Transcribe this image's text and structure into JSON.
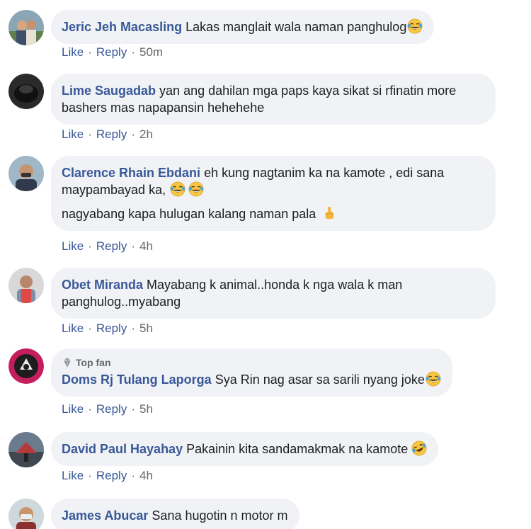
{
  "comments": [
    {
      "author": "Jeric Jeh Macasling",
      "text": "Lakas manglait wala naman panghulog",
      "emoji": "joy-emoji",
      "like": "Like",
      "reply": "Reply",
      "time": "50m"
    },
    {
      "author": "Lime Saugadab",
      "text": "yan ang dahilan mga paps kaya sikat si rfinatin more bashers mas napapansin hehehehe",
      "like": "Like",
      "reply": "Reply",
      "time": "2h"
    },
    {
      "author": "Clarence Rhain Ebdani",
      "text": "eh kung nagtanim ka na kamote , edi sana maypambayad ka,",
      "text2": "nagyabang kapa hulugan kalang naman pala",
      "emoji": "joy-emoji",
      "emoji2": "middle-finger-emoji",
      "like": "Like",
      "reply": "Reply",
      "time": "4h"
    },
    {
      "author": "Obet Miranda",
      "text": "Mayabang k animal..honda k nga wala k man panghulog..myabang",
      "like": "Like",
      "reply": "Reply",
      "time": "5h"
    },
    {
      "badge": "Top fan",
      "author": "Doms Rj Tulang Laporga",
      "text": "Sya Rin nag asar sa sarili nyang joke",
      "emoji": "joy-emoji",
      "like": "Like",
      "reply": "Reply",
      "time": "5h"
    },
    {
      "author": "David Paul Hayahay",
      "text": "Pakainin kita sandamakmak na kamote",
      "emoji": "rofl-emoji",
      "like": "Like",
      "reply": "Reply",
      "time": "4h"
    },
    {
      "author": "James Abucar",
      "text": "Sana hugotin n motor m"
    }
  ],
  "colors": {
    "author": "#385898",
    "bubble": "#f0f2f5",
    "text": "#1c1e21",
    "meta": "#65676b"
  }
}
